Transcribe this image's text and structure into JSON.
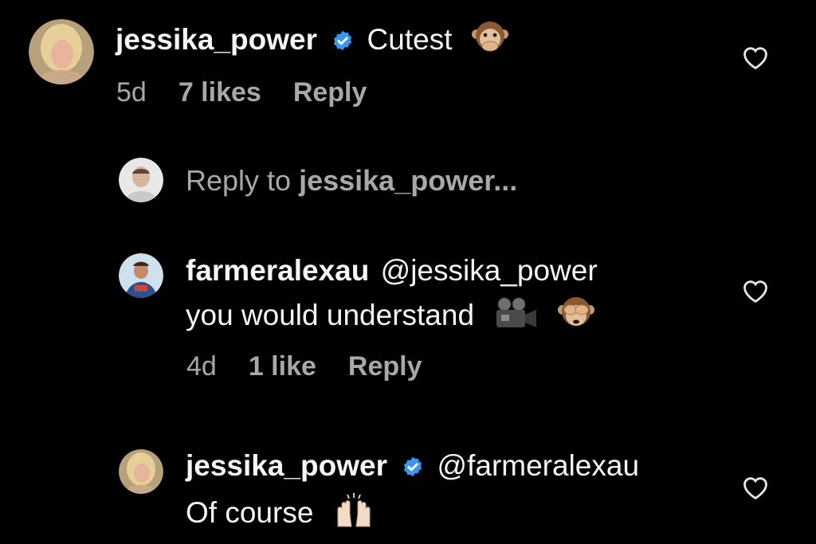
{
  "comments": [
    {
      "username": "jessika_power",
      "verified": true,
      "text": "Cutest",
      "emoji": "speak-no-evil-monkey",
      "age": "5d",
      "likes": "7 likes",
      "reply": "Reply"
    },
    {
      "username": "farmeralexau",
      "verified": false,
      "mention": "@jessika_power",
      "text": "you would understand",
      "emojis": [
        "movie-camera",
        "see-no-evil-monkey"
      ],
      "age": "4d",
      "likes": "1 like",
      "reply": "Reply"
    },
    {
      "username": "jessika_power",
      "verified": true,
      "mention": "@farmeralexau",
      "text": "Of course",
      "emoji": "raising-hands"
    }
  ],
  "reply_prompt": {
    "prefix": "Reply to ",
    "target": "jessika_power..."
  },
  "colors": {
    "background": "#000000",
    "text": "#f5f5f5",
    "secondary": "#a8a8a8",
    "verified": "#3897f0"
  }
}
